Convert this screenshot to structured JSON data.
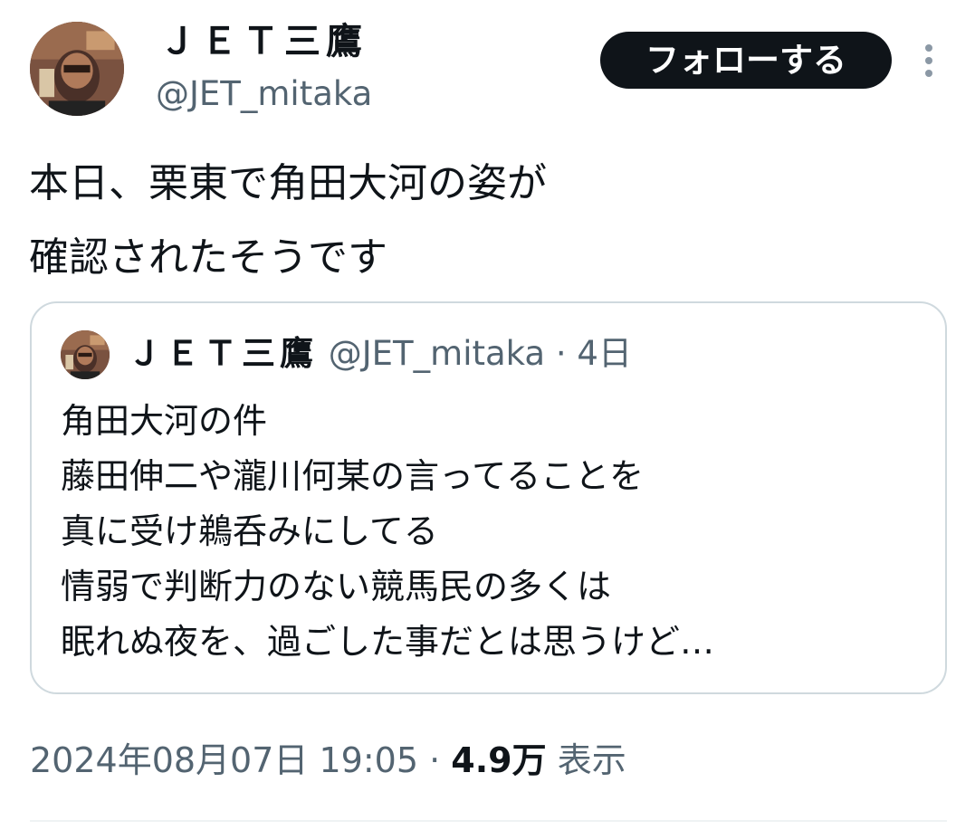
{
  "author": {
    "display_name": "ＪＥＴ三鷹",
    "handle": "@JET_mitaka"
  },
  "follow_button": {
    "label": "フォローする"
  },
  "tweet": {
    "text": "本日、栗東で角田大河の姿が\n確認されたそうです"
  },
  "quote": {
    "display_name": "ＪＥＴ三鷹",
    "handle": "@JET_mitaka",
    "separator": "·",
    "time": "4日",
    "text": "角田大河の件\n藤田伸二や瀧川何某の言ってることを\n真に受け鵜呑みにしてる\n情弱で判断力のない競馬民の多くは\n眠れぬ夜を、過ごした事だとは思うけど…"
  },
  "meta": {
    "timestamp": "2024年08月07日 19:05",
    "separator": "·",
    "views_count": "4.9万",
    "views_label": "表示"
  },
  "colors": {
    "primary_text": "#0f1419",
    "secondary_text": "#536471",
    "border": "#cfd9de",
    "follow_button_bg": "#0f1419"
  },
  "icons": {
    "more": "more-vertical-icon"
  }
}
